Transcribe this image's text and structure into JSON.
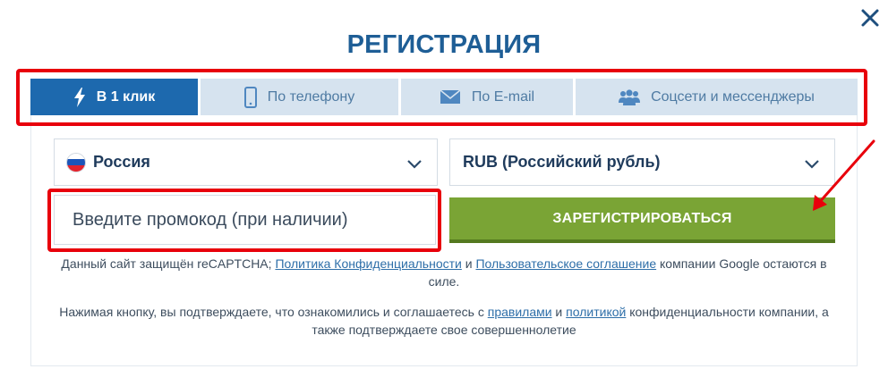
{
  "dialog": {
    "title": "РЕГИСТРАЦИЯ",
    "close_icon": "close-icon"
  },
  "tabs": [
    {
      "label": "В 1 клик",
      "icon": "lightning-icon",
      "active": true
    },
    {
      "label": "По телефону",
      "icon": "phone-icon",
      "active": false
    },
    {
      "label": "По E-mail",
      "icon": "envelope-icon",
      "active": false
    },
    {
      "label": "Соцсети и мессенджеры",
      "icon": "users-icon",
      "active": false
    }
  ],
  "form": {
    "country": {
      "value": "Россия",
      "flag_icon": "russia-flag-icon"
    },
    "currency": {
      "value": "RUB (Российский рубль)"
    },
    "promo": {
      "placeholder": "Введите промокод (при наличии)",
      "value": ""
    },
    "register_label": "ЗАРЕГИСТРИРОВАТЬСЯ"
  },
  "recaptcha_note": {
    "part1": "Данный сайт защищён reCAPTCHA; ",
    "privacy_link": "Политика Конфиденциальности",
    "part2": " и ",
    "terms_link": "Пользовательское соглашение",
    "part3": " компании Google остаются в силе."
  },
  "agreement_note": {
    "part1": "Нажимая кнопку, вы подтверждаете, что ознакомились и соглашаетесь с ",
    "rules_link": "правилами",
    "part2": " и ",
    "policy_link": "политикой",
    "part3": " конфиденциальности компании, а также подтверждаете свое совершеннолетие"
  },
  "colors": {
    "title": "#1e5e96",
    "tab_active": "#1d69ae",
    "tab_inactive": "#d6e3ef",
    "register_button": "#7aa435",
    "annotation": "#e8000b",
    "link": "#2d6ea8"
  }
}
